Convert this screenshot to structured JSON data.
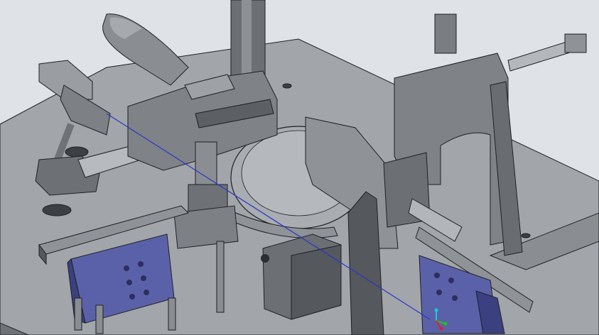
{
  "scene": {
    "kind": "cad-3d-assembly-view",
    "colors": {
      "background": "#dfe2e6",
      "plate_top": "#9ea1a5",
      "plate_side": "#6f7276",
      "metal_light": "#b9bcc0",
      "metal_mid": "#8f9296",
      "metal_dark": "#55585c",
      "edge": "#1f2124",
      "fixture_blue": "#5b61a8",
      "fixture_blue_dark": "#3b4080",
      "datum_line": "#2b35c9",
      "triad_x": "#e02020",
      "triad_y": "#22c022",
      "triad_z": "#20c8d8"
    }
  }
}
